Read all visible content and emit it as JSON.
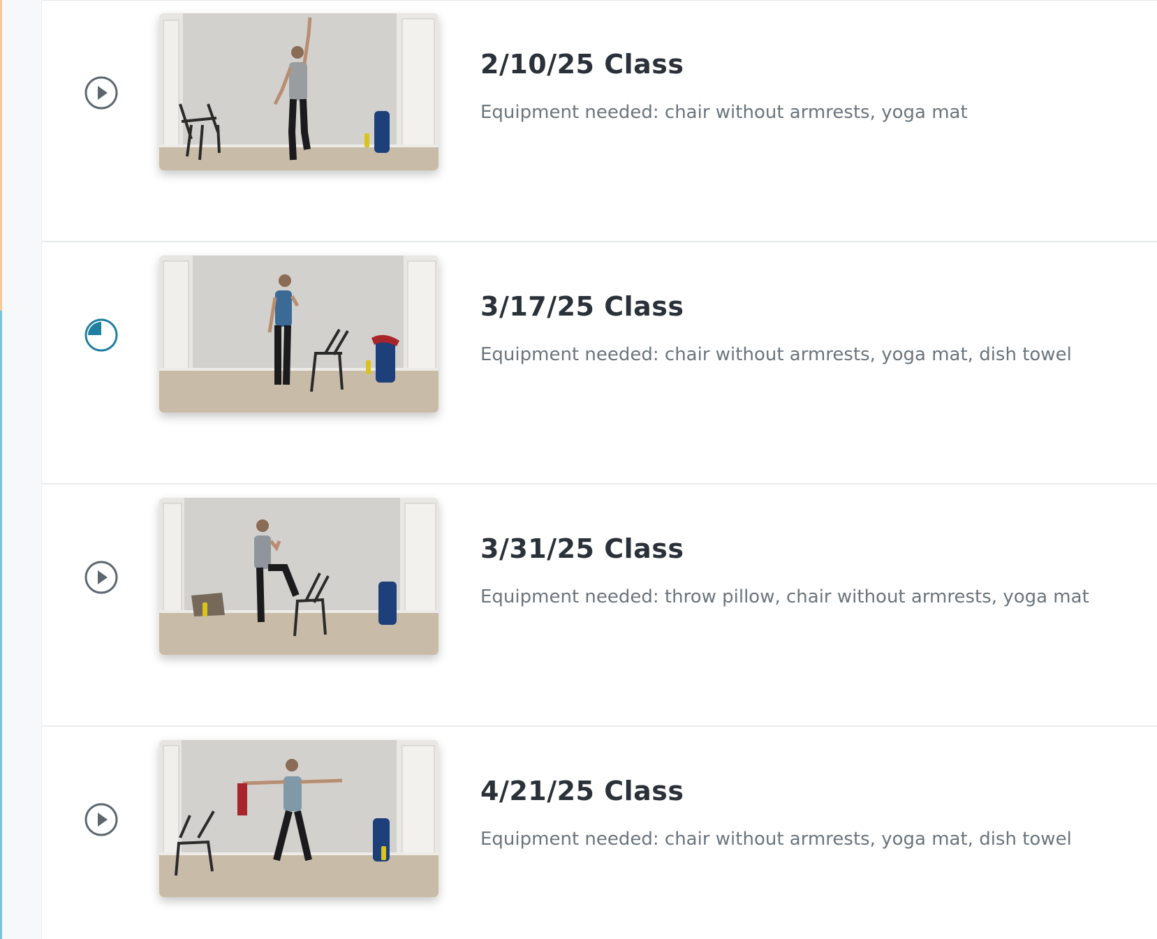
{
  "lessons": [
    {
      "status": "not-started",
      "status_icon": "play-circle-icon",
      "title": "2/10/25 Class",
      "description": "Equipment needed: chair without armrests, yoga mat",
      "thumbnail": "class-thumbnail-reach-up"
    },
    {
      "status": "in-progress",
      "status_icon": "progress-circle-icon",
      "progress": 0.25,
      "title": "3/17/25 Class",
      "description": "Equipment needed: chair without armrests, yoga mat, dish towel",
      "thumbnail": "class-thumbnail-side-reach"
    },
    {
      "status": "not-started",
      "status_icon": "play-circle-icon",
      "title": "3/31/25 Class",
      "description": "Equipment needed: throw pillow, chair without armrests, yoga mat",
      "thumbnail": "class-thumbnail-knee-lift"
    },
    {
      "status": "not-started",
      "status_icon": "play-circle-icon",
      "title": "4/21/25 Class",
      "description": "Equipment needed: chair without armrests, yoga mat, dish towel",
      "thumbnail": "class-thumbnail-arms-out"
    }
  ],
  "colors": {
    "title": "#2b3138",
    "description": "#6b747c",
    "icon_gray": "#5d6670",
    "progress_accent": "#1f7fa0"
  }
}
